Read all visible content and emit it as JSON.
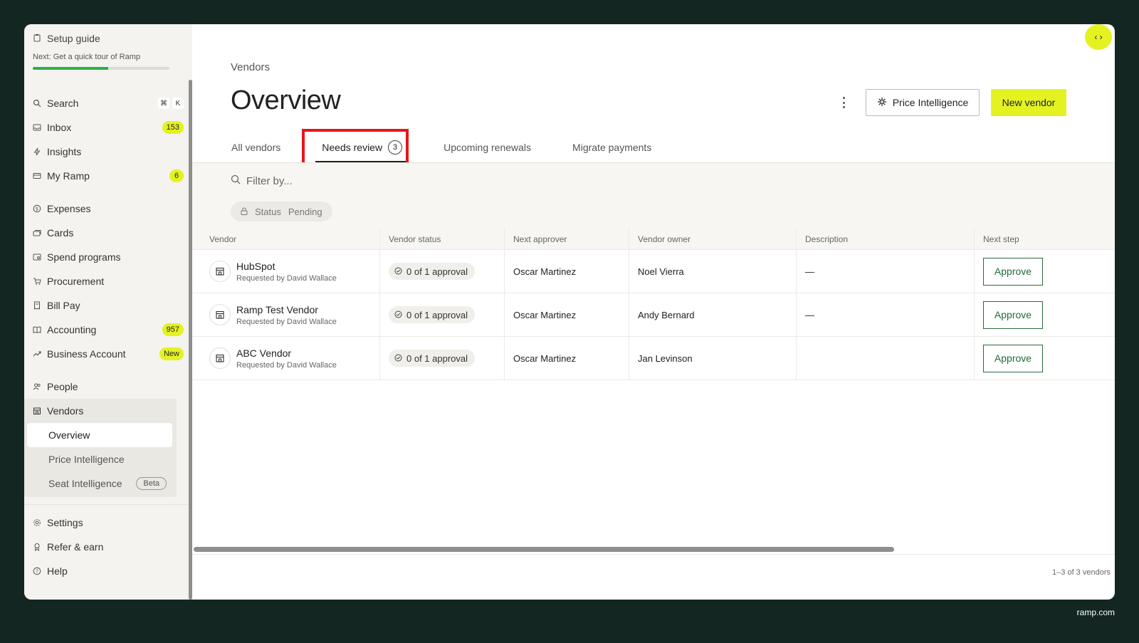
{
  "sidebar": {
    "setup": {
      "title": "Setup guide",
      "next": "Next: Get a quick tour of Ramp",
      "progress": 0.55
    },
    "search": {
      "label": "Search",
      "kbd1": "⌘",
      "kbd2": "K"
    },
    "items_top": [
      {
        "label": "Inbox",
        "badge": "153",
        "icon": "inbox-icon"
      },
      {
        "label": "Insights",
        "badge": "",
        "icon": "bolt-icon"
      },
      {
        "label": "My Ramp",
        "badge": "6",
        "icon": "card-icon"
      }
    ],
    "items_mid": [
      {
        "label": "Expenses",
        "badge": "",
        "icon": "dollar-icon"
      },
      {
        "label": "Cards",
        "badge": "",
        "icon": "cards-icon"
      },
      {
        "label": "Spend programs",
        "badge": "",
        "icon": "program-icon"
      },
      {
        "label": "Procurement",
        "badge": "",
        "icon": "cart-icon"
      },
      {
        "label": "Bill Pay",
        "badge": "",
        "icon": "bill-icon"
      },
      {
        "label": "Accounting",
        "badge": "957",
        "icon": "book-icon"
      },
      {
        "label": "Business Account",
        "badge": "New",
        "icon": "trend-icon"
      }
    ],
    "people": "People",
    "vendors": {
      "label": "Vendors",
      "sub": [
        {
          "label": "Overview",
          "active": true,
          "pill": ""
        },
        {
          "label": "Price Intelligence",
          "active": false,
          "pill": ""
        },
        {
          "label": "Seat Intelligence",
          "active": false,
          "pill": "Beta"
        }
      ]
    },
    "bottom": [
      {
        "label": "Settings",
        "icon": "gear-icon"
      },
      {
        "label": "Refer & earn",
        "icon": "gift-icon"
      },
      {
        "label": "Help",
        "icon": "help-icon"
      }
    ]
  },
  "header": {
    "breadcrumb": "Vendors",
    "title": "Overview",
    "price_intelligence_label": "Price Intelligence",
    "new_vendor_label": "New vendor",
    "corner_label": "‹ ›"
  },
  "tabs": [
    {
      "label": "All vendors",
      "count": ""
    },
    {
      "label": "Needs review",
      "count": "3"
    },
    {
      "label": "Upcoming renewals",
      "count": ""
    },
    {
      "label": "Migrate payments",
      "count": ""
    }
  ],
  "filter": {
    "placeholder": "Filter by...",
    "chip_key": "Status",
    "chip_value": "Pending"
  },
  "table": {
    "columns": [
      "Vendor",
      "Vendor status",
      "Next approver",
      "Vendor owner",
      "Description",
      "Next step"
    ],
    "rows": [
      {
        "vendor": "HubSpot",
        "requested": "Requested by David Wallace",
        "status": "0 of 1 approval",
        "approver": "Oscar Martinez",
        "owner": "Noel Vierra",
        "description": "—",
        "action": "Approve"
      },
      {
        "vendor": "Ramp Test Vendor",
        "requested": "Requested by David Wallace",
        "status": "0 of 1 approval",
        "approver": "Oscar Martinez",
        "owner": "Andy Bernard",
        "description": "—",
        "action": "Approve"
      },
      {
        "vendor": "ABC Vendor",
        "requested": "Requested by David Wallace",
        "status": "0 of 1 approval",
        "approver": "Oscar Martinez",
        "owner": "Jan Levinson",
        "description": "",
        "action": "Approve"
      }
    ]
  },
  "pager": "1–3 of 3 vendors",
  "brand": "ramp.com",
  "colors": {
    "accent": "#e4f222",
    "background": "#132622",
    "highlight": "#e8151b",
    "progress": "#2bb04b"
  }
}
